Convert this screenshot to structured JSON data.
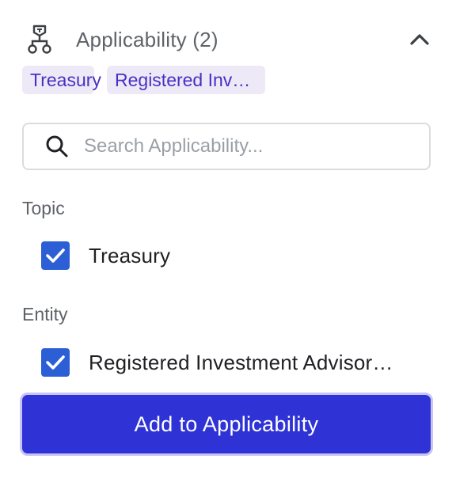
{
  "header": {
    "icon": "org-hierarchy-icon",
    "title": "Applicability (2)",
    "collapse_icon": "chevron-up-icon"
  },
  "chips": [
    {
      "label": "Treasury"
    },
    {
      "label": "Registered Inv…"
    }
  ],
  "search": {
    "placeholder": "Search Applicability...",
    "value": ""
  },
  "groups": [
    {
      "label": "Topic",
      "options": [
        {
          "label": "Treasury",
          "checked": true
        }
      ]
    },
    {
      "label": "Entity",
      "options": [
        {
          "label": "Registered Investment Advisor…",
          "checked": true
        }
      ]
    }
  ],
  "actions": {
    "add_label": "Add to Applicability"
  },
  "colors": {
    "chip_bg": "#ede9f7",
    "chip_text": "#4a30c4",
    "checkbox": "#2c5fd6",
    "primary_button": "#2f33d6",
    "primary_button_border": "#c9c4f5"
  }
}
